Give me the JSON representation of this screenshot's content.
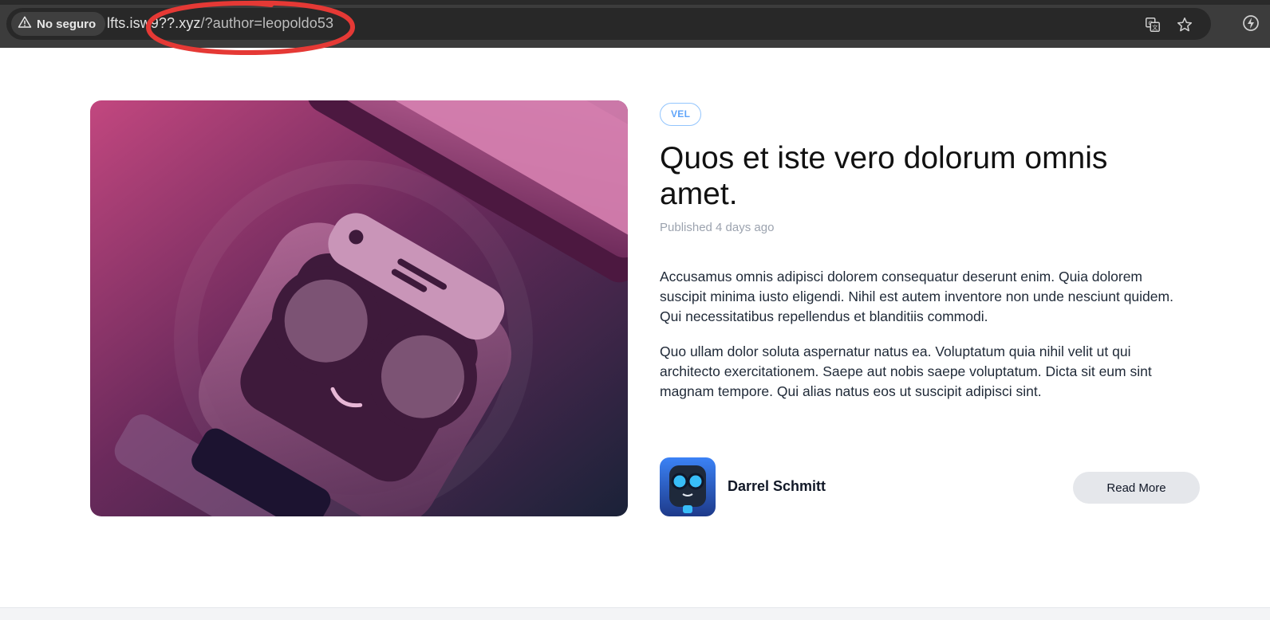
{
  "browser": {
    "security_label": "No seguro",
    "url_host": "lfts.isw9??.xyz",
    "url_path": "/?author=leopoldo53",
    "icons": [
      "warning-icon",
      "translate-icon",
      "star-icon",
      "performance-icon"
    ]
  },
  "annotation": {
    "color": "#e53935",
    "shape": "ellipse"
  },
  "post": {
    "category_tag": "VEL",
    "title": "Quos et iste vero dolorum omnis amet.",
    "published": "Published 4 days ago",
    "paragraphs": [
      "Accusamus omnis adipisci dolorem consequatur deserunt enim. Quia dolorem suscipit minima iusto eligendi. Nihil est autem inventore non unde nesciunt quidem. Qui necessitatibus repellendus et blanditiis commodi.",
      "Quo ullam dolor soluta aspernatur natus ea. Voluptatum quia nihil velit ut qui architecto exercitationem. Saepe aut nobis saepe voluptatum. Dicta sit eum sint magnam tempore. Qui alias natus eos ut suscipit adipisci sint."
    ],
    "author": {
      "name": "Darrel Schmitt"
    },
    "read_more_label": "Read More"
  },
  "colors": {
    "tag_border": "#93c5fd",
    "tag_text": "#60a5fa",
    "button_bg": "#e5e7eb",
    "hero_gradient_start": "#c2477f",
    "hero_gradient_end": "#1a2238"
  }
}
